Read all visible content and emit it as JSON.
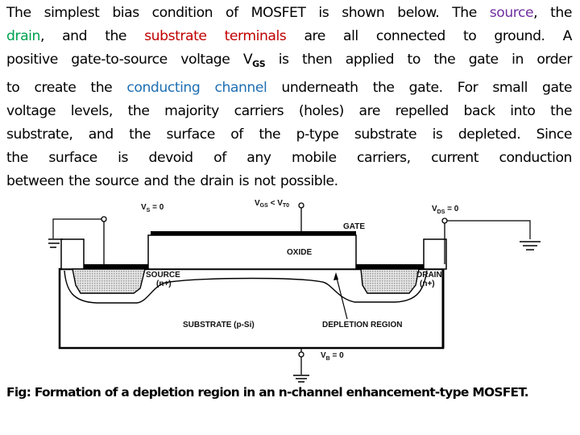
{
  "paragraph": {
    "lines": [
      [
        {
          "text": "The simplest bias condition of MOSFET is shown below. The ",
          "style": "plain"
        },
        {
          "text": "source",
          "style": "source"
        },
        {
          "text": ",  the",
          "style": "plain"
        }
      ],
      [
        {
          "text": "drain",
          "style": "drain"
        },
        {
          "text": ",  and  the  ",
          "style": "plain"
        },
        {
          "text": "substrate  terminals",
          "style": "substrate"
        },
        {
          "text": "  are   all  connected   to  ground.  A",
          "style": "plain"
        }
      ],
      [
        {
          "text": "positive gate-to-source  voltage V",
          "style": "plain"
        },
        {
          "text": "GS",
          "style": "sub"
        },
        {
          "text": "  is then applied to the gate in order",
          "style": "plain"
        }
      ],
      [
        {
          "text": "to create the ",
          "style": "plain"
        },
        {
          "text": "conducting  channel",
          "style": "channel"
        },
        {
          "text": " underneath  the gate. For small  gate",
          "style": "plain"
        }
      ],
      [
        {
          "text": "voltage levels,  the majority  carriers  (holes)  are repelled back  into the",
          "style": "plain"
        }
      ],
      [
        {
          "text": "substrate,  and the surface of the p-type  substrate  is  depleted. Since",
          "style": "plain"
        }
      ],
      [
        {
          "text": "the  surface  is  devoid  of any  mobile carriers, current  conduction",
          "style": "plain"
        }
      ],
      [
        {
          "text": "between  the source  and  the  drain is  not possible.",
          "style": "plain"
        }
      ]
    ],
    "colors": {
      "source": "#7030a0",
      "drain": "#00a050",
      "substrate": "#c00000",
      "channel": "#1f6fb2"
    }
  },
  "diagram": {
    "labels": {
      "vs": "V",
      "vs_sub": "S",
      "vs_eq": " = 0",
      "vgs": "V",
      "vgs_sub": "GS",
      "vgs_lt": " < V",
      "vgs_sub2": "T0",
      "vds": "V",
      "vds_sub": "DS",
      "vds_eq": " = 0",
      "vb": "V",
      "vb_sub": "B",
      "vb_eq": " = 0",
      "gate": "GATE",
      "oxide": "OXIDE",
      "source": "SOURCE",
      "source_type": "(n+)",
      "drain": "DRAIN",
      "drain_type": "(n+)",
      "substrate": "SUBSTRATE  (p-Si)",
      "depletion": "DEPLETION REGION"
    },
    "icons": [
      "ground-icon-source",
      "ground-icon-drain",
      "ground-icon-body"
    ]
  },
  "caption": "Fig: Formation  of a  depletion  region in  an  n-channel  enhancement-type  MOSFET."
}
